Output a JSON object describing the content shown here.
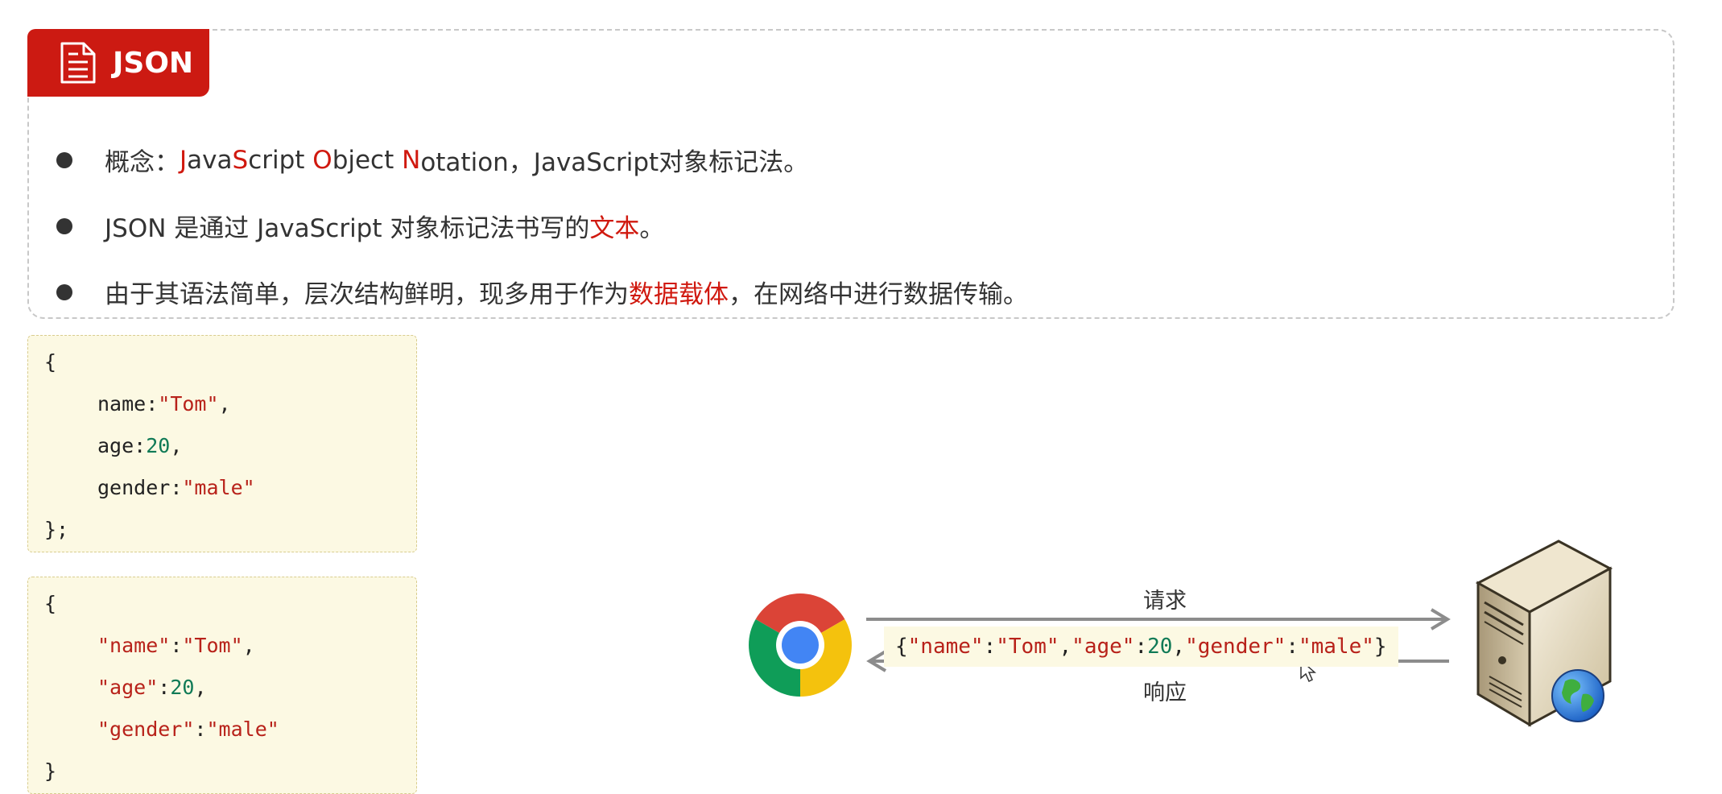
{
  "header": {
    "title": "JSON",
    "icon": "document-icon",
    "accent_color": "#cc1a12"
  },
  "bullets": [
    {
      "prefix": "概念：",
      "parts": [
        {
          "text": "J",
          "red": true
        },
        {
          "text": "ava",
          "red": false
        },
        {
          "text": "S",
          "red": true
        },
        {
          "text": "cript ",
          "red": false
        },
        {
          "text": "O",
          "red": true
        },
        {
          "text": "bject ",
          "red": false
        },
        {
          "text": "N",
          "red": true
        },
        {
          "text": "otation，JavaScript对象标记法。",
          "red": false
        }
      ]
    },
    {
      "before": "JSON 是通过 JavaScript 对象标记法书写的",
      "highlight": "文本",
      "after": "。"
    },
    {
      "before": "由于其语法简单，层次结构鲜明，现多用于作为",
      "highlight": "数据载体",
      "after": "，在网络中进行数据传输。"
    }
  ],
  "code_js_object": {
    "open": "{",
    "lines": [
      {
        "key": "name",
        "sep": ":",
        "value": "\"Tom\"",
        "type": "str",
        "tail": ","
      },
      {
        "key": "age",
        "sep": ":",
        "value": "20",
        "type": "num",
        "tail": ","
      },
      {
        "key": "gender",
        "sep": ":",
        "value": "\"male\"",
        "type": "str",
        "tail": ""
      }
    ],
    "close": "};"
  },
  "code_json": {
    "open": "{",
    "lines": [
      {
        "key": "\"name\"",
        "sep": ":",
        "value": "\"Tom\"",
        "type": "str",
        "tail": ","
      },
      {
        "key": "\"age\"",
        "sep": ":",
        "value": "20",
        "type": "num",
        "tail": ","
      },
      {
        "key": "\"gender\"",
        "sep": ":",
        "value": "\"male\"",
        "type": "str",
        "tail": ""
      }
    ],
    "close": "}"
  },
  "diagram": {
    "request_label": "请求",
    "response_label": "响应",
    "payload": {
      "open": "{",
      "p1": "\"name\"",
      "c1": ":",
      "v1": "\"Tom\"",
      "s1": ",",
      "p2": "\"age\"",
      "c2": ":",
      "v2": "20",
      "s2": ",",
      "p3": "\"gender\"",
      "c3": ":",
      "v3": "\"male\"",
      "close": "}"
    },
    "browser_icon": "chrome-browser-icon",
    "server_icon": "web-server-icon"
  }
}
